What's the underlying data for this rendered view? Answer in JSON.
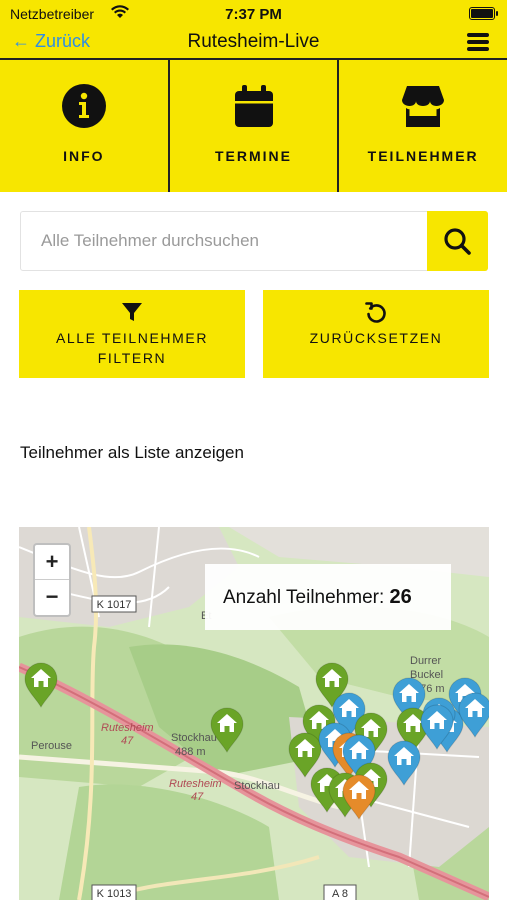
{
  "statusbar": {
    "carrier": "Netzbetreiber",
    "time": "7:37 PM"
  },
  "navbar": {
    "back_label": "← Zurück",
    "title": "Rutesheim-Live"
  },
  "tabs": [
    {
      "label": "INFO",
      "icon": "info-icon"
    },
    {
      "label": "TERMINE",
      "icon": "calendar-icon"
    },
    {
      "label": "TEILNEHMER",
      "icon": "store-icon"
    }
  ],
  "search": {
    "placeholder": "Alle Teilnehmer durchsuchen",
    "value": ""
  },
  "buttons": {
    "filter_line1": "ALLE TEILNEHMER",
    "filter_line2": "FILTERN",
    "reset": "ZURÜCKSETZEN"
  },
  "list_link": "Teilnehmer als Liste anzeigen",
  "map": {
    "zoom_in": "+",
    "zoom_out": "−",
    "count_label": "Anzahl Teilnehmer:",
    "count_value": "26",
    "labels": {
      "road_k1017": "K 1017",
      "road_k1013": "K 1013",
      "road_a8": "A 8",
      "rutesheim_47_a": "Rutesheim",
      "rutesheim_47_a_num": "47",
      "rutesheim_47_b": "Rutesheim",
      "rutesheim_47_b_num": "47",
      "stockhau": "Stockhau",
      "stockhau_alt": "488 m",
      "stockhau2": "Stockhau",
      "durrer": "Durrer",
      "buckel": "Buckel",
      "buckel_alt": "476 m",
      "perouse": "Perouse",
      "et": "Et"
    }
  },
  "colors": {
    "accent": "#f7e600",
    "link": "#2f8ee5",
    "pin_green": "#6aa427",
    "pin_blue": "#3e9fd6",
    "pin_orange": "#e58b2a"
  }
}
